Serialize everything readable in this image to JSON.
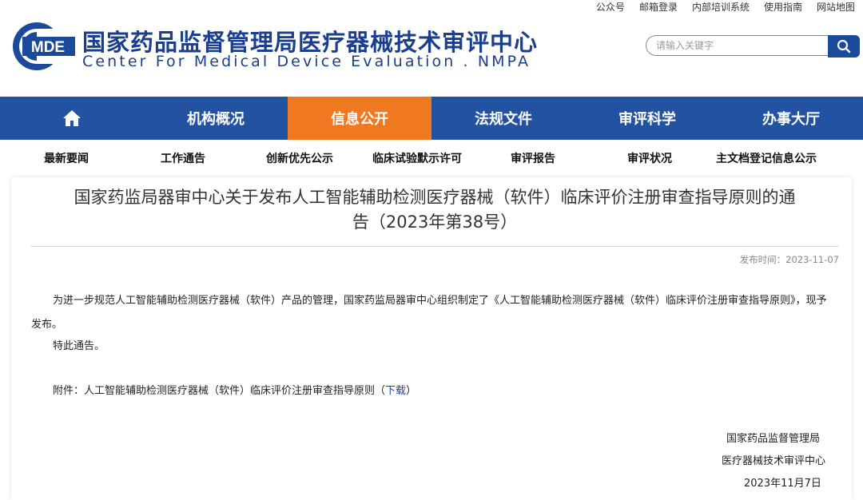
{
  "top_links": [
    "公众号",
    "邮箱登录",
    "内部培训系统",
    "使用指南",
    "网站地图"
  ],
  "logo_text": "MDE",
  "site_title_cn": "国家药品监督管理局医疗器械技术审评中心",
  "site_title_en": "Center For Medical Device Evaluation . NMPA",
  "search": {
    "placeholder": "请输入关键字"
  },
  "nav": [
    {
      "label": "",
      "icon": "home-icon"
    },
    {
      "label": "机构概况"
    },
    {
      "label": "信息公开"
    },
    {
      "label": "法规文件"
    },
    {
      "label": "审评科学"
    },
    {
      "label": "办事大厅"
    }
  ],
  "subnav": [
    "最新要闻",
    "工作通告",
    "创新优先公示",
    "临床试验默示许可",
    "审评报告",
    "审评状况",
    "主文档登记信息公示"
  ],
  "article": {
    "title_line1": "国家药监局器审中心关于发布人工智能辅助检测医疗器械（软件）临床评价注册审查指导原则的通",
    "title_line2": "告（2023年第38号）",
    "pub_date": "发布时间：2023-11-07",
    "para1": "为进一步规范人工智能辅助检测医疗器械（软件）产品的管理，国家药监局器审中心组织制定了《人工智能辅助检测医疗器械（软件）临床评价注册审查指导原则》，现予发布。",
    "para2": "特此通告。",
    "attach_prefix": "附件：人工智能辅助检测医疗器械（软件）临床评价注册审查指导原则（",
    "attach_link": "下载",
    "attach_suffix": "）",
    "sign_org1": "国家药品监督管理局",
    "sign_org2": "医疗器械技术审评中心",
    "sign_date": "2023年11月7日"
  },
  "colors": {
    "brand_blue": "#2353a0",
    "active_orange": "#f07820",
    "title_blue": "#1b3f8f"
  }
}
